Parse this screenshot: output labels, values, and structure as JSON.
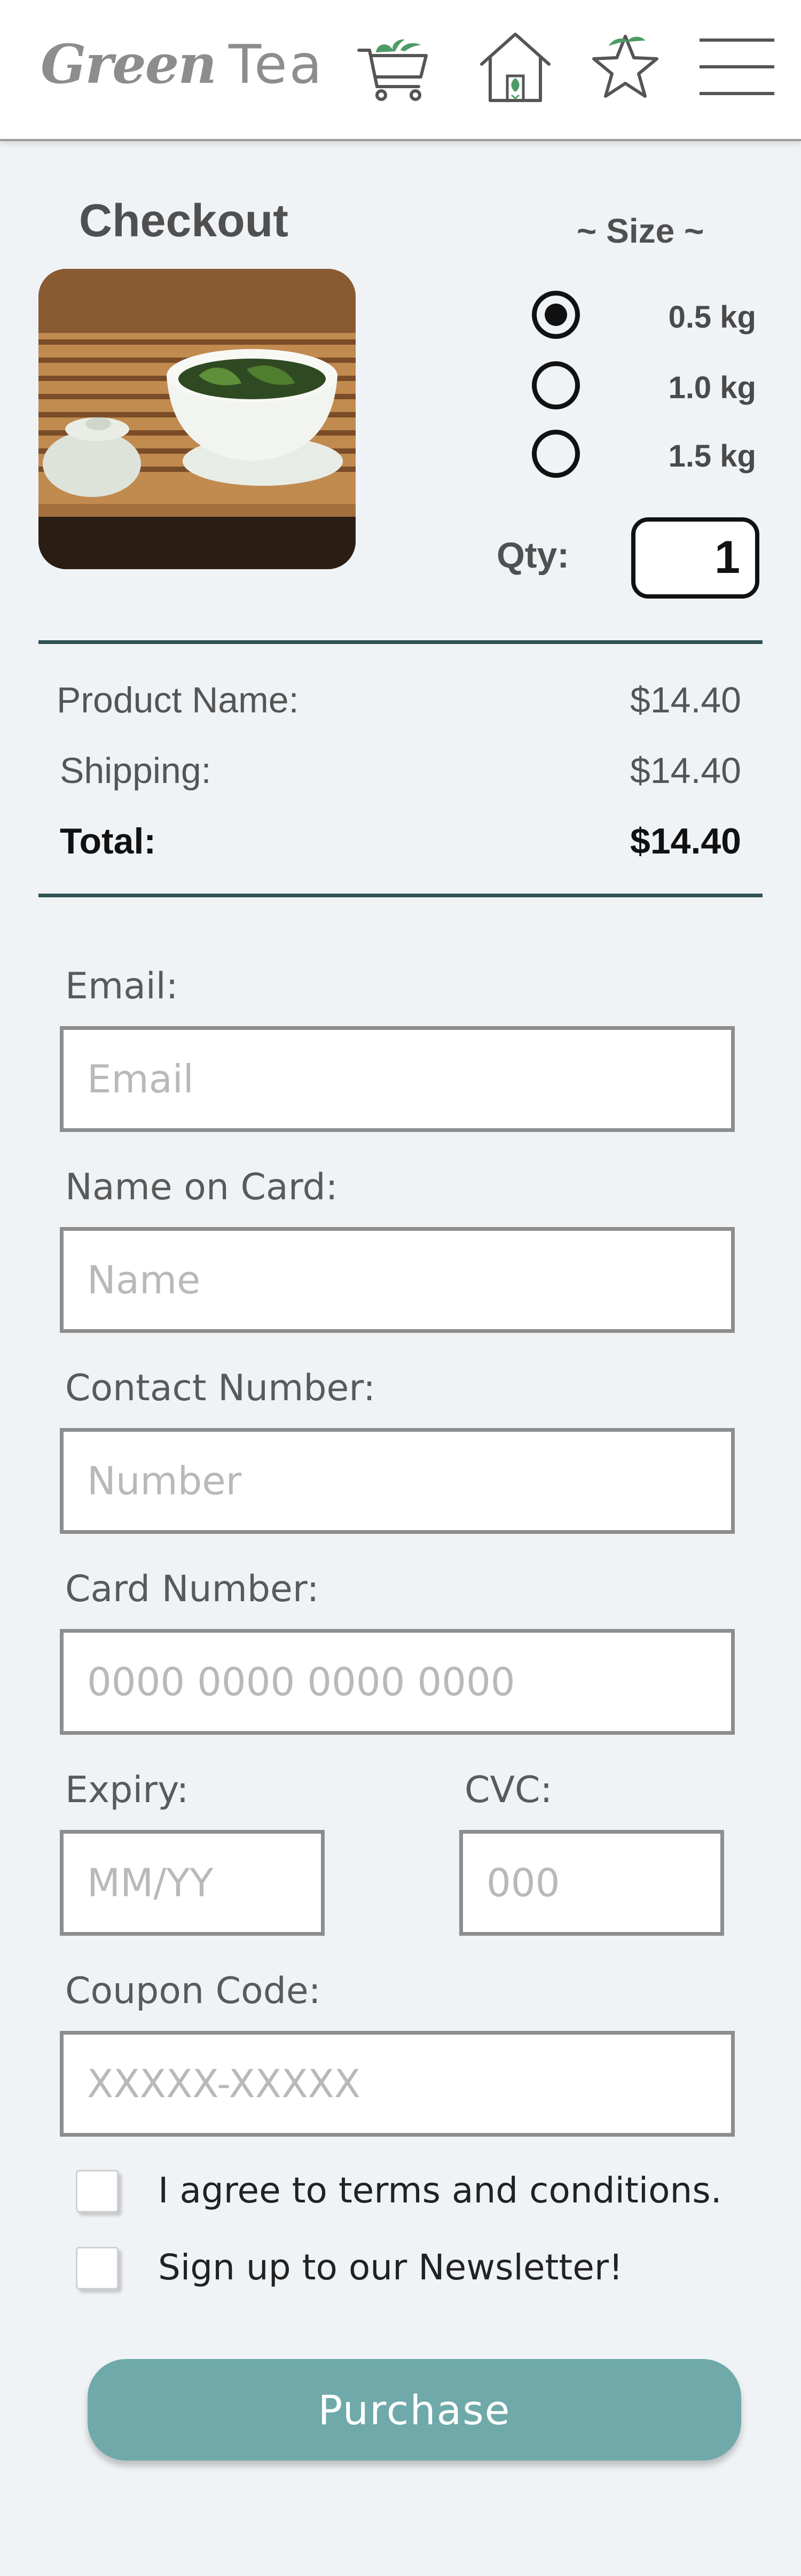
{
  "header": {
    "logo_word1": "Green",
    "logo_word2": "Tea",
    "icons": [
      "cart-icon",
      "home-icon",
      "star-icon",
      "hamburger-menu-icon"
    ]
  },
  "product": {
    "title": "Checkout",
    "image_alt": "Green tea leaves in a white gaiwan cup on a wooden tea tray",
    "size_title": "~ Size ~",
    "sizes": [
      {
        "label": "0.5 kg",
        "selected": true
      },
      {
        "label": "1.0 kg",
        "selected": false
      },
      {
        "label": "1.5 kg",
        "selected": false
      }
    ],
    "qty_label": "Qty:",
    "qty_value": "1"
  },
  "summary": {
    "product_label": "Product Name:",
    "product_price": "$14.40",
    "shipping_label": "Shipping:",
    "shipping_price": "$14.40",
    "total_label": "Total:",
    "total_price": "$14.40"
  },
  "form": {
    "email_label": "Email:",
    "email_placeholder": "Email",
    "name_label": "Name on Card:",
    "name_placeholder": "Name",
    "contact_label": "Contact Number:",
    "contact_placeholder": "Number",
    "card_label": "Card Number:",
    "card_placeholder": "0000 0000 0000 0000",
    "expiry_label": "Expiry:",
    "expiry_placeholder": "MM/YY",
    "cvc_label": "CVC:",
    "cvc_placeholder": "000",
    "coupon_label": "Coupon Code:",
    "coupon_placeholder": "XXXXX-XXXXX",
    "terms_text": "I agree to terms and conditions.",
    "newsletter_text": "Sign up to our Newsletter!",
    "purchase_label": "Purchase"
  },
  "colors": {
    "accent": "#6fa9a9",
    "divider": "#2f5253",
    "background": "#f0f3f6",
    "leaf_green": "#4d9b67"
  }
}
